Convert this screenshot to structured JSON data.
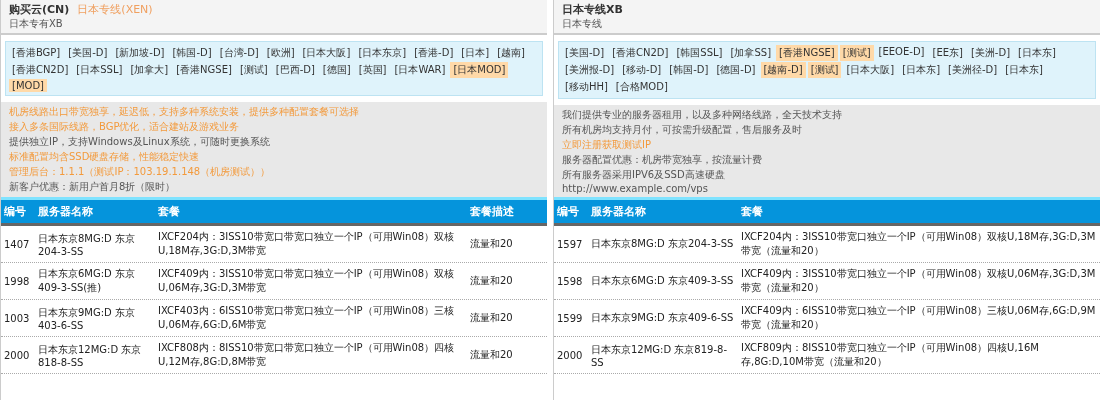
{
  "panels": [
    {
      "title": "购买云(CN)",
      "accent": "日本专线(XEN)",
      "subtitle": "日本专有XB",
      "tags": [
        {
          "label": "[香港BGP]",
          "selected": false
        },
        {
          "label": "[美国-D]",
          "selected": false
        },
        {
          "label": "[新加坡-D]",
          "selected": false
        },
        {
          "label": "[韩国-D]",
          "selected": false
        },
        {
          "label": "[台湾-D]",
          "selected": false
        },
        {
          "label": "[欧洲]",
          "selected": false
        },
        {
          "label": "[日本大阪]",
          "selected": false
        },
        {
          "label": "[日本东京]",
          "selected": false
        },
        {
          "label": "[香港-D]",
          "selected": false
        },
        {
          "label": "[日本]",
          "selected": false
        },
        {
          "label": "[越南]",
          "selected": false
        },
        {
          "label": "[香港CN2D]",
          "selected": false
        },
        {
          "label": "[日本SSL]",
          "selected": false
        },
        {
          "label": "[加拿大]",
          "selected": false
        },
        {
          "label": "[香港NGSE]",
          "selected": false
        },
        {
          "label": "[测试]",
          "selected": false
        },
        {
          "label": "[巴西-D]",
          "selected": false
        },
        {
          "label": "[德国]",
          "selected": false
        },
        {
          "label": "[英国]",
          "selected": false
        },
        {
          "label": "[日本WAR]",
          "selected": false
        },
        {
          "label": "[日本MOD]",
          "selected": true
        },
        {
          "label": "[MOD]",
          "selected": true
        }
      ],
      "notices": [
        {
          "text": "机房线路出口带宽独享，延迟低，支持多种系统安装，提供多种配置套餐可选择",
          "kind": "highlight"
        },
        {
          "text": "接入多条国际线路，BGP优化，适合建站及游戏业务",
          "kind": "highlight"
        },
        {
          "text": "提供独立IP，支持Windows及Linux系统，可随时更换系统",
          "kind": "plain"
        },
        {
          "text": "标准配置均含SSD硬盘存储，性能稳定快速",
          "kind": "highlight"
        },
        {
          "text": "管理后台：1.1.1（测试IP：103.19.1.148（机房测试））",
          "kind": "highlight"
        },
        {
          "text": "新客户优惠：新用户首月8折（限时）",
          "kind": "plain"
        }
      ],
      "columns": [
        "编号",
        "服务器名称",
        "套餐",
        "套餐描述"
      ],
      "rows": [
        [
          "1407",
          "日本东京8MG:D 东京204-3-SS",
          "IXCF204内：3ISS10带宽口带宽口独立一个IP（可用Win08）双核U,18M存,3G:D,3M带宽",
          "流量和20"
        ],
        [
          "1998",
          "日本东京6MG:D 东京409-3-SS(推)",
          "IXCF409内：3ISS10带宽口带宽口独立一个IP（可用Win08）双核U,06M存,3G:D,3M带宽",
          "流量和20"
        ],
        [
          "1003",
          "日本东京9MG:D 东京403-6-SS",
          "IXCF403内：6ISS10带宽口带宽口独立一个IP（可用Win08）三核U,06M存,6G:D,6M带宽",
          "流量和20"
        ],
        [
          "2000",
          "日本东京12MG:D 东京818-8-SS",
          "IXCF808内：8ISS10带宽口带宽口独立一个IP（可用Win08）四核U,12M存,8G:D,8M带宽",
          "流量和20"
        ]
      ]
    },
    {
      "title": "日本专线XB",
      "subtitle": "日本专线",
      "tags": [
        {
          "label": "[美国-D]",
          "selected": false
        },
        {
          "label": "[香港CN2D]",
          "selected": false
        },
        {
          "label": "[韩国SSL]",
          "selected": false
        },
        {
          "label": "[加拿SS]",
          "selected": false
        },
        {
          "label": "[香港NGSE]",
          "selected": true
        },
        {
          "label": "[测试]",
          "selected": true
        },
        {
          "label": "[EEOE-D]",
          "selected": false
        },
        {
          "label": "[EE东]",
          "selected": false
        },
        {
          "label": "[美洲-D]",
          "selected": false
        },
        {
          "label": "[日本东]",
          "selected": false
        },
        {
          "label": "[美洲报-D]",
          "selected": false
        },
        {
          "label": "[移动-D]",
          "selected": false
        },
        {
          "label": "[韩国-D]",
          "selected": false
        },
        {
          "label": "[德国-D]",
          "selected": false
        },
        {
          "label": "[越南-D]",
          "selected": true
        },
        {
          "label": "[测试]",
          "selected": true
        },
        {
          "label": "[日本大阪]",
          "selected": false
        },
        {
          "label": "[日本东]",
          "selected": false
        },
        {
          "label": "[美洲径-D]",
          "selected": false
        },
        {
          "label": "[日本东]",
          "selected": false
        },
        {
          "label": "[移动HH]",
          "selected": false
        },
        {
          "label": "[合格MOD]",
          "selected": false
        }
      ],
      "notices": [
        {
          "text": "我们提供专业的服务器租用，以及多种网络线路，全天技术支持",
          "kind": "plain"
        },
        {
          "text": "所有机房均支持月付，可按需升级配置，售后服务及时",
          "kind": "plain"
        },
        {
          "text": "立即注册获取测试IP",
          "kind": "highlight"
        },
        {
          "text": "服务器配置优惠：机房带宽独享，按流量计费",
          "kind": "plain"
        },
        {
          "text": "所有服务器采用IPV6及SSD高速硬盘",
          "kind": "plain"
        },
        {
          "text": "http://www.example.com/vps",
          "kind": "plain"
        }
      ],
      "columns": [
        "编号",
        "服务器名称",
        "套餐"
      ],
      "rows": [
        [
          "1597",
          "日本东京8MG:D 东京204-3-SS",
          "IXCF204内：3ISS10带宽口独立一个IP（可用Win08）双核U,18M存,3G:D,3M带宽（流量和20）"
        ],
        [
          "1598",
          "日本东京6MG:D 东京409-3-SS",
          "IXCF409内：3ISS10带宽口独立一个IP（可用Win08）双核U,06M存,3G:D,3M带宽（流量和20）"
        ],
        [
          "1599",
          "日本东京9MG:D 东京409-6-SS",
          "IXCF409内：6ISS10带宽口独立一个IP（可用Win08）三核U,06M存,6G:D,9M带宽（流量和20）"
        ],
        [
          "2000",
          "日本东京12MG:D 东京819-8-SS",
          "IXCF809内：8ISS10带宽口独立一个IP（可用Win08）四核U,16M存,8G:D,10M带宽（流量和20）"
        ]
      ]
    }
  ]
}
